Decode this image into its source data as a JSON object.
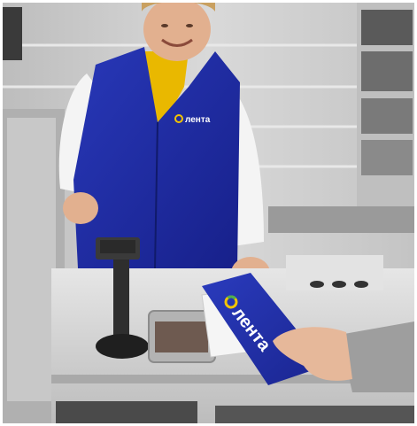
{
  "photo": {
    "subject": "cashier",
    "vest_logo_text": "лента",
    "envelope_logo_text": "лента",
    "receipt_text": "",
    "colors": {
      "brand_blue": "#1f2fa6",
      "brand_blue_dark": "#15207a",
      "logo_yellow": "#f2c400",
      "logo_green": "#4caf50",
      "background_gray": "#c9c9c9",
      "counter_gray": "#d8d8d8",
      "skin": "#e6b89a",
      "sweater_gray": "#9e9e9e"
    }
  }
}
